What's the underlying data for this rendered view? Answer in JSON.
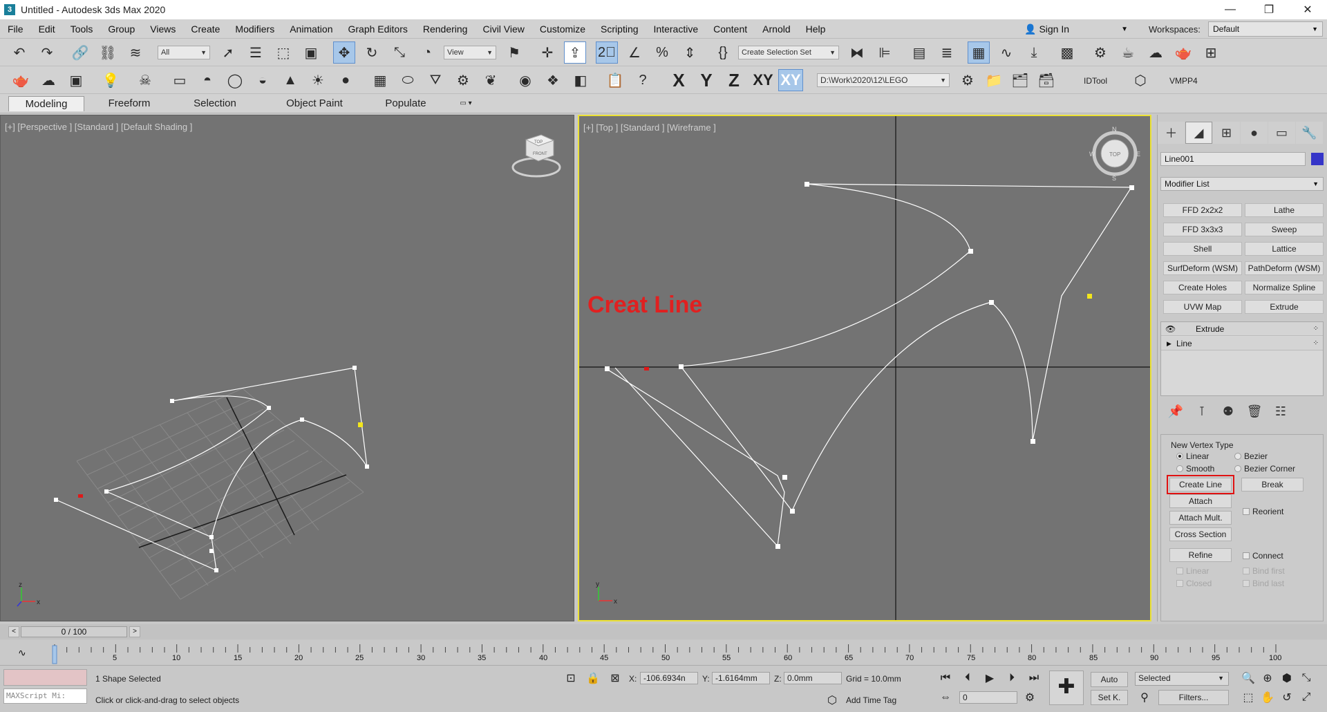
{
  "window": {
    "title": "Untitled - Autodesk 3ds Max 2020",
    "minimize": "—",
    "maximize": "❐",
    "close": "✕"
  },
  "menu": [
    "File",
    "Edit",
    "Tools",
    "Group",
    "Views",
    "Create",
    "Modifiers",
    "Animation",
    "Graph Editors",
    "Rendering",
    "Civil View",
    "Customize",
    "Scripting",
    "Interactive",
    "Content",
    "Arnold",
    "Help"
  ],
  "account": {
    "sign_in": "Sign In",
    "workspaces_label": "Workspaces:",
    "workspace": "Default"
  },
  "toolbar1": {
    "selection_filter": "All",
    "ref_coord": "View",
    "named_selection": "Create Selection Set"
  },
  "toolbar2": {
    "project_path": "D:\\Work\\2020\\12\\LEGO",
    "axis_x": "X",
    "axis_y": "Y",
    "axis_z": "Z",
    "axis_xy": "XY",
    "axis_xy_active": "XY",
    "idtool": "IDTool",
    "vmpp4": "VMPP4"
  },
  "ribbon": {
    "tabs": [
      "Modeling",
      "Freeform",
      "Selection",
      "Object Paint",
      "Populate"
    ]
  },
  "viewports": {
    "perspective_label": "[+] [Perspective ] [Standard ] [Default Shading ]",
    "top_label": "[+] [Top ] [Standard ] [Wireframe ]",
    "annotation": "Creat Line",
    "cube_top": "TOP",
    "cube_front": "FRONT",
    "compass_n": "N",
    "compass_s": "S",
    "compass_w": "W",
    "compass_e": "E",
    "axis_x": "x",
    "axis_y": "y",
    "axis_z": "z"
  },
  "command_panel": {
    "object_name": "Line001",
    "object_color": "#3535c8",
    "modifier_list": "Modifier List",
    "modifier_buttons": [
      "FFD 2x2x2",
      "Lathe",
      "FFD 3x3x3",
      "Sweep",
      "Shell",
      "Lattice",
      "SurfDeform (WSM)",
      "PathDeform (WSM)",
      "Create Holes",
      "Normalize Spline",
      "UVW Map",
      "Extrude"
    ],
    "stack": [
      "Extrude",
      "Line"
    ],
    "vertex_type_title": "New Vertex Type",
    "linear": "Linear",
    "bezier": "Bezier",
    "smooth": "Smooth",
    "bezier_corner": "Bezier Corner",
    "create_line": "Create Line",
    "break": "Break",
    "attach": "Attach",
    "reorient": "Reorient",
    "attach_mult": "Attach Mult.",
    "cross_section": "Cross Section",
    "refine": "Refine",
    "connect": "Connect",
    "refine_linear": "Linear",
    "bind_first": "Bind first",
    "closed": "Closed",
    "bind_last": "Bind last"
  },
  "timeline": {
    "frame": "0 / 100",
    "prev": "<",
    "next": ">",
    "ticks": [
      "5",
      "10",
      "15",
      "20",
      "25",
      "30",
      "35",
      "40",
      "45",
      "50",
      "55",
      "60",
      "65",
      "70",
      "75",
      "80",
      "85",
      "90",
      "95",
      "100"
    ]
  },
  "status": {
    "maxscript": "MAXScript Mi:",
    "selected": "1 Shape Selected",
    "prompt": "Click or click-and-drag to select objects",
    "x_label": "X:",
    "x_value": "-106.6934n",
    "y_label": "Y:",
    "y_value": "-1.6164mm",
    "z_label": "Z:",
    "z_value": "0.0mm",
    "grid": "Grid = 10.0mm",
    "add_time_tag": "Add Time Tag",
    "auto": "Auto",
    "set_key": "Set K.",
    "selected_set": "Selected",
    "filters": "Filters...",
    "current_frame": "0"
  }
}
